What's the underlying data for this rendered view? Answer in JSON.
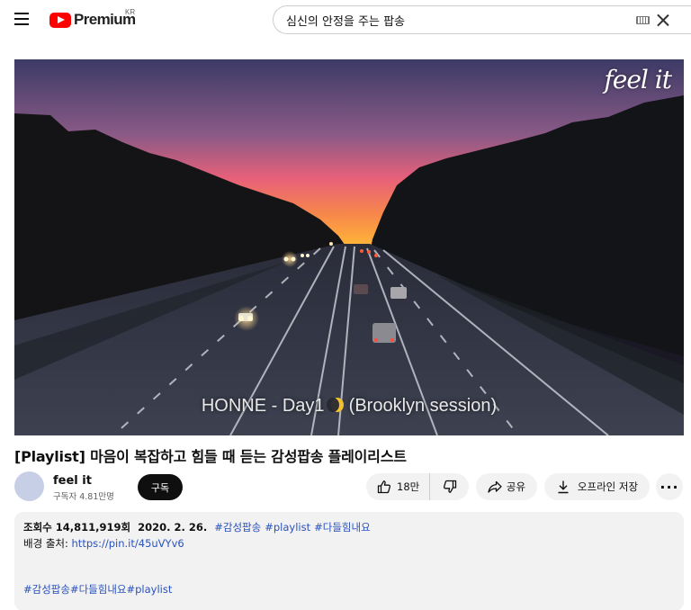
{
  "header": {
    "logo_text": "Premium",
    "logo_region": "KR",
    "search_value": "심신의 안정을 주는 팝송"
  },
  "video": {
    "watermark": "feel it",
    "caption_before": "HONNE - Day1",
    "caption_after": "(Brooklyn session)"
  },
  "title": "[Playlist] 마음이 복잡하고 힘들 때 듣는 감성팝송 플레이리스트",
  "channel": {
    "name": "feel it",
    "subscribers": "구독자 4.81만명",
    "subscribe_label": "구독"
  },
  "actions": {
    "like_count": "18만",
    "share_label": "공유",
    "offline_label": "오프라인 저장",
    "more_label": "···"
  },
  "description": {
    "views": "조회수 14,811,919회",
    "date": "2020. 2. 26.",
    "tags": [
      "#감성팝송",
      "#playlist",
      "#다들힘내요"
    ],
    "source_label": "배경 출처:",
    "source_link": "https://pin.it/45uVYv6",
    "bottom_tags": "#감성팝송#다들힘내요#playlist"
  },
  "colors": {
    "accent_red": "#ff0000",
    "link_blue": "#2a52be",
    "pill_bg": "#f2f2f2"
  }
}
